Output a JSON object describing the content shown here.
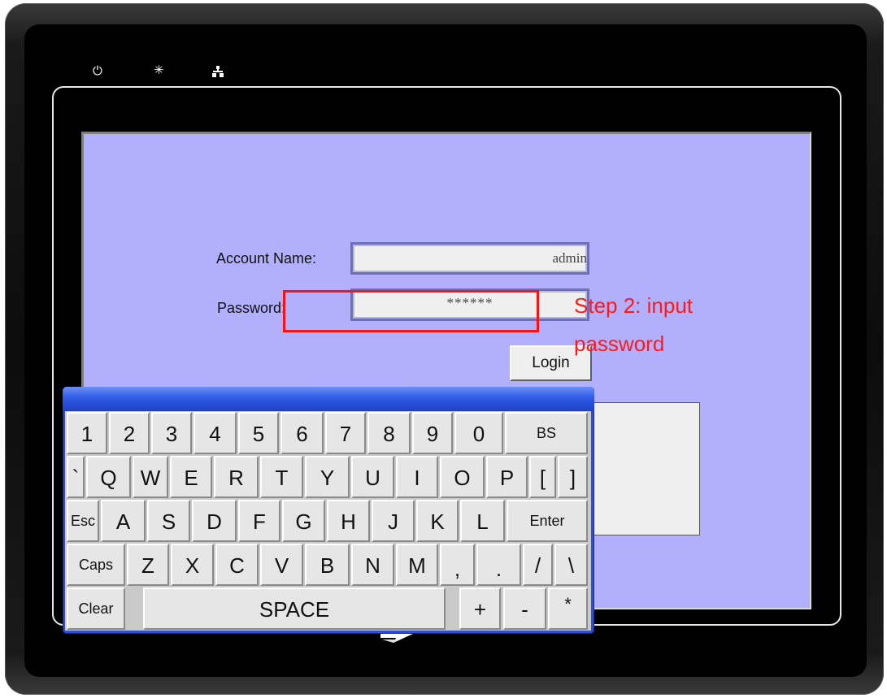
{
  "device": {
    "leds": [
      {
        "name": "power-led-icon",
        "glyph": "⏻"
      },
      {
        "name": "run-led-icon",
        "glyph": "✳"
      },
      {
        "name": "network-led-icon",
        "glyph": "⚏"
      }
    ]
  },
  "login": {
    "account_label": "Account Name:",
    "account_value": "admin",
    "password_label": "Password:",
    "password_value": "******",
    "login_button": "Login"
  },
  "annotation": {
    "text_line1": "Step 2: input",
    "text_line2": "password",
    "color": "#ff1a1a"
  },
  "keyboard": {
    "rows": [
      [
        "1",
        "2",
        "3",
        "4",
        "5",
        "6",
        "7",
        "8",
        "9",
        "0",
        "BS"
      ],
      [
        "`",
        "Q",
        "W",
        "E",
        "R",
        "T",
        "Y",
        "U",
        "I",
        "O",
        "P",
        "[",
        "]"
      ],
      [
        "Esc",
        "A",
        "S",
        "D",
        "F",
        "G",
        "H",
        "J",
        "K",
        "L",
        "Enter"
      ],
      [
        "Caps",
        "Z",
        "X",
        "C",
        "V",
        "B",
        "N",
        "M",
        ",",
        ".",
        "/",
        "\\"
      ],
      [
        "Clear",
        "SPACE",
        "+",
        "-",
        "*"
      ]
    ]
  },
  "colors": {
    "screen_background": "#b2b0fd",
    "keyboard_title_bar": "#2f5be6",
    "highlight": "#ff1010"
  }
}
